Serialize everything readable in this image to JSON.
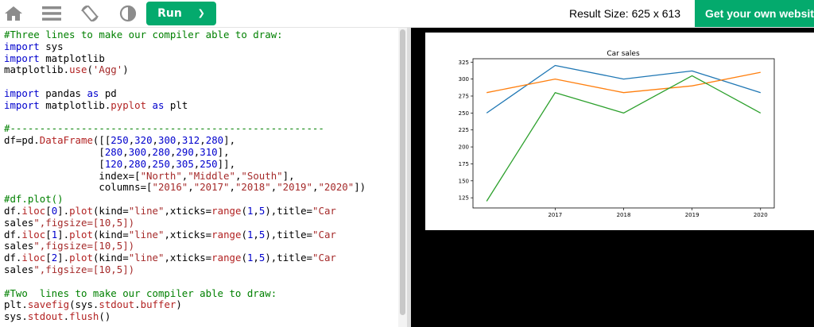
{
  "toolbar": {
    "home_icon": "home-icon",
    "menu_icon": "menu-icon",
    "rotate_icon": "rotate-screen-icon",
    "theme_icon": "contrast-icon",
    "run_label": "Run",
    "run_chevron": "❯",
    "result_size_text": "Result Size: 625 x 613",
    "get_website_label": "Get your own website",
    "accent_color": "#04aa6d"
  },
  "editor": {
    "lines": [
      "#Three lines to make our compiler able to draw:",
      "import sys",
      "import matplotlib",
      "matplotlib.use('Agg')",
      "",
      "import pandas as pd",
      "import matplotlib.pyplot as plt",
      "",
      "#-----------------------------------------------------",
      "df=pd.DataFrame([[250,320,300,312,280],",
      "                [280,300,280,290,310],",
      "                [120,280,250,305,250]],",
      "                index=[\"North\",\"Middle\",\"South\"],",
      "                columns=[\"2016\",\"2017\",\"2018\",\"2019\",\"2020\"])",
      "#df.plot()",
      "df.iloc[0].plot(kind=\"line\",xticks=range(1,5),title=\"Car",
      "sales\",figsize=[10,5])",
      "df.iloc[1].plot(kind=\"line\",xticks=range(1,5),title=\"Car",
      "sales\",figsize=[10,5])",
      "df.iloc[2].plot(kind=\"line\",xticks=range(1,5),title=\"Car",
      "sales\",figsize=[10,5])",
      "",
      "#Two  lines to make our compiler able to draw:",
      "plt.savefig(sys.stdout.buffer)",
      "sys.stdout.flush()"
    ]
  },
  "chart_data": {
    "type": "line",
    "title": "Car sales",
    "xlabel": "",
    "ylabel": "",
    "x": [
      0,
      1,
      2,
      3,
      4
    ],
    "xticks": [
      1,
      2,
      3,
      4
    ],
    "xtick_labels": [
      "2017",
      "2018",
      "2019",
      "2020"
    ],
    "ylim": [
      110,
      330
    ],
    "yticks": [
      125,
      150,
      175,
      200,
      225,
      250,
      275,
      300,
      325
    ],
    "grid": false,
    "series": [
      {
        "values": [
          250,
          320,
          300,
          312,
          280
        ],
        "color": "#1f77b4"
      },
      {
        "values": [
          280,
          300,
          280,
          290,
          310
        ],
        "color": "#ff7f0e"
      },
      {
        "values": [
          120,
          280,
          250,
          305,
          250
        ],
        "color": "#2ca02c"
      }
    ]
  }
}
